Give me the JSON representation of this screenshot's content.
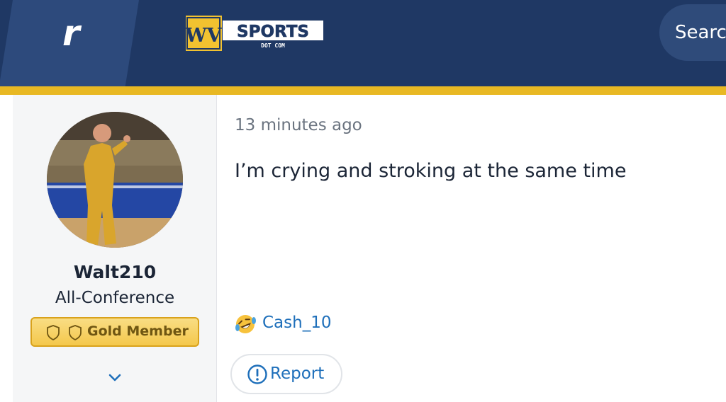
{
  "header": {
    "brand_glyph": "r",
    "site_logo": {
      "letters": "WV",
      "name": "SPORTS",
      "sub": "DOT COM"
    },
    "search_label": "Search"
  },
  "author": {
    "username": "Walt210",
    "rank": "All-Conference",
    "badge_label": "Gold Member"
  },
  "post": {
    "timestamp": "13 minutes ago",
    "body": "I’m crying and stroking at the same time",
    "reaction": {
      "emoji": "rolling-on-floor-laughing",
      "user": "Cash_10"
    },
    "report_label": "Report"
  },
  "colors": {
    "header_bg": "#1f3864",
    "accent_gold": "#e8b823",
    "link_blue": "#1e6fba",
    "sidebar_bg": "#f5f6f7"
  },
  "icons": [
    "rivals-logo-icon",
    "wvsports-logo",
    "shield-icon",
    "chevron-down-icon",
    "laughing-emoji-icon",
    "exclamation-circle-icon"
  ]
}
